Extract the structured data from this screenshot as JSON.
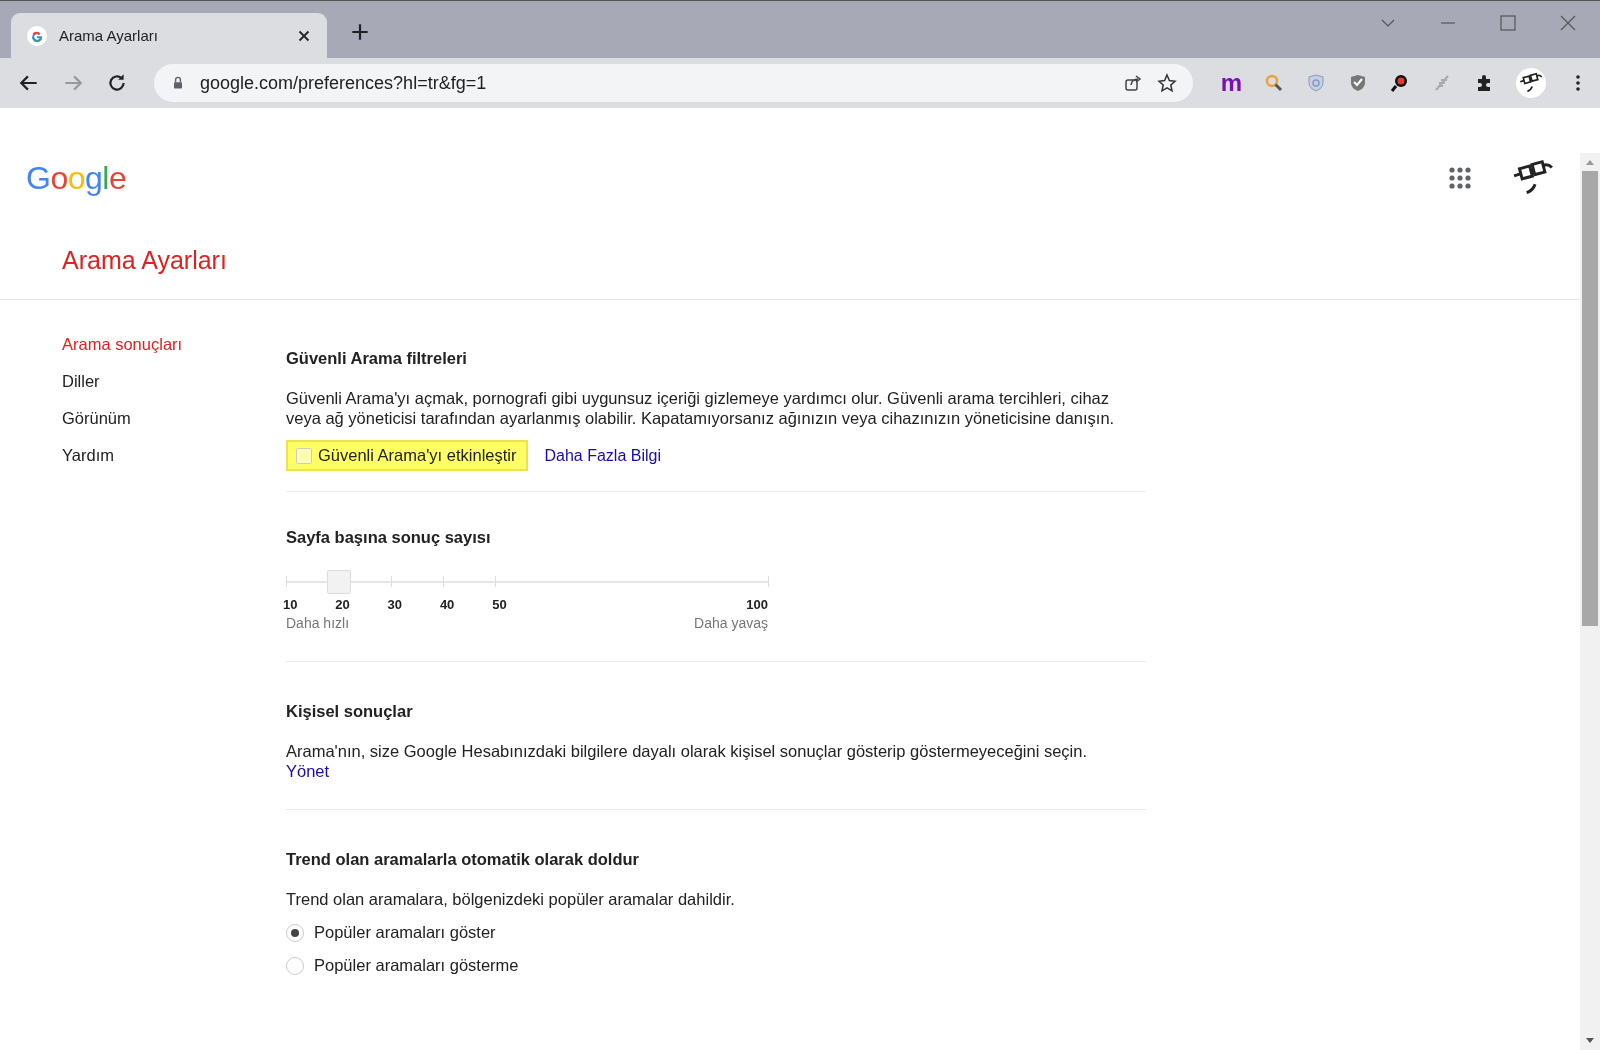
{
  "browser": {
    "tab": {
      "title": "Arama Ayarları",
      "selected": true
    },
    "address": "google.com/preferences?hl=tr&fg=1",
    "extension_letter": "m"
  },
  "header": {
    "logo": "Google"
  },
  "page_title": "Arama Ayarları",
  "sidebar": {
    "items": [
      {
        "label": "Arama sonuçları",
        "selected": true
      },
      {
        "label": "Diller",
        "selected": false
      },
      {
        "label": "Görünüm",
        "selected": false
      },
      {
        "label": "Yardım",
        "selected": false
      }
    ]
  },
  "safe_search": {
    "title": "Güvenli Arama filtreleri",
    "description": "Güvenli Arama'yı açmak, pornografi gibi uygunsuz içeriği gizlemeye yardımcı olur. Güvenli arama tercihleri, cihaz veya ağ yöneticisi tarafından ayarlanmış olabilir. Kapatamıyorsanız ağınızın veya cihazınızın yöneticisine danışın.",
    "checkbox": {
      "label": "Güvenli Arama'yı etkinleştir",
      "checked": false
    },
    "link": "Daha Fazla Bilgi"
  },
  "results_per_page": {
    "title": "Sayfa başına sonuç sayısı",
    "slider": {
      "level": 0.11
    },
    "ticks": [
      "10",
      "20",
      "30",
      "40",
      "50",
      "100"
    ],
    "left_hint": "Daha hızlı",
    "right_hint": "Daha yavaş"
  },
  "personal": {
    "title": "Kişisel sonuçlar",
    "description": "Arama'nın, size Google Hesabınızdaki bilgilere dayalı olarak kişisel sonuçlar gösterip göstermeyeceğini seçin.",
    "link": "Yönet"
  },
  "trending": {
    "title": "Trend olan aramalarla otomatik olarak doldur",
    "description": "Trend olan aramalara, bölgenizdeki popüler aramalar dahildir.",
    "options": [
      {
        "label": "Popüler aramaları göster",
        "selected": true
      },
      {
        "label": "Popüler aramaları gösterme",
        "selected": false
      }
    ]
  }
}
